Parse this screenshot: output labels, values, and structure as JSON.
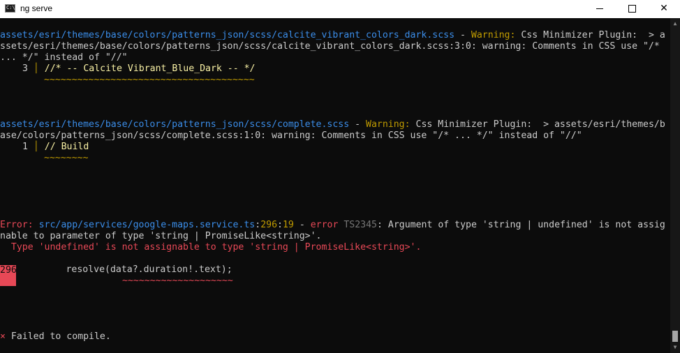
{
  "window": {
    "icon_text": "C:\\",
    "title": "ng serve"
  },
  "warning1": {
    "path": "assets/esri/themes/base/colors/patterns_json/scss/calcite_vibrant_colors_dark.scss",
    "sep": " - ",
    "label": "Warning:",
    "message": " Css Minimizer Plugin:  > a",
    "line2": "ssets/esri/themes/base/colors/patterns_json/scss/calcite_vibrant_colors_dark.scss:3:0: warning: Comments in CSS use \"/*",
    "line3": "... */\" instead of \"//\"",
    "code_line_no": "3",
    "code": "//* -- Calcite Vibrant_Blue_Dark -- */",
    "squiggle": "~~~~~~~~~~~~~~~~~~~~~~~~~~~~~~~~~~~~~~"
  },
  "warning2": {
    "path": "assets/esri/themes/base/colors/patterns_json/scss/complete.scss",
    "sep": " - ",
    "label": "Warning:",
    "message": " Css Minimizer Plugin:  > assets/esri/themes/b",
    "line2": "ase/colors/patterns_json/scss/complete.scss:1:0: warning: Comments in CSS use \"/* ... */\" instead of \"//\"",
    "code_line_no": "1",
    "code": "// Build",
    "squiggle": "~~~~~~~~"
  },
  "error": {
    "label": "Error:",
    "file": "src/app/services/google-maps.service.ts",
    "colon1": ":",
    "line": "296",
    "colon2": ":",
    "col": "19",
    "sep": " - ",
    "kind": "error",
    "code": "TS2345",
    "message": ": Argument of type 'string | undefined' is not assig",
    "line2": "nable to parameter of type 'string | PromiseLike<string>'.",
    "line3": "  Type 'undefined' is not assignable to type 'string | PromiseLike<string>'.",
    "code_line_no": "296",
    "source": "         resolve(data?.duration!.text);",
    "squiggle": "~~~~~~~~~~~~~~~~~~~~"
  },
  "status": {
    "icon": "×",
    "text": " Failed to compile."
  },
  "scrollbar": {
    "up": "▲",
    "down": "▼"
  }
}
